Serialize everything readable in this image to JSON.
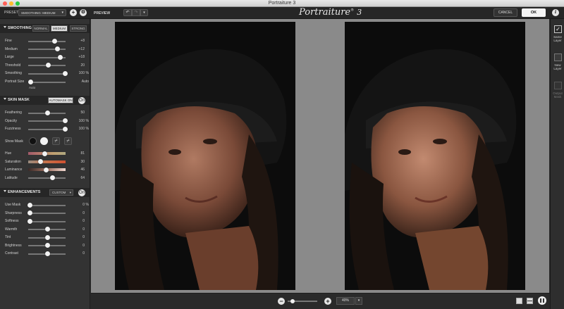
{
  "window": {
    "title": "Portraiture 3"
  },
  "toolbar": {
    "preset_label": "PRESET",
    "preset_value": "SMOOTHING: MEDIUM",
    "preview_label": "PREVIEW",
    "app_logo": "Portraiture",
    "app_logo_sup": "®",
    "app_logo_ver": "3",
    "cancel_label": "CANCEL",
    "ok_label": "OK"
  },
  "smoothing": {
    "header": "SMOOTHING",
    "modes": [
      "NORMAL",
      "MEDIUM",
      "STRONG"
    ],
    "active_mode": "MEDIUM",
    "sliders": [
      {
        "name": "Fine",
        "value": "+8",
        "fraction": 0.7
      },
      {
        "name": "Medium",
        "value": "+12",
        "fraction": 0.78
      },
      {
        "name": "Large",
        "value": "+18",
        "fraction": 0.85
      },
      {
        "name": "Threshold",
        "value": "20",
        "fraction": 0.52
      },
      {
        "name": "Smoothing",
        "value": "100",
        "unit": "%",
        "fraction": 1.0
      }
    ],
    "portrait_size": {
      "name": "Portrait Size",
      "value": "Auto",
      "sub": "Auto",
      "fraction": 0.0
    }
  },
  "skin_mask": {
    "header": "SKIN MASK",
    "automask_label": "AUTOMASK ON",
    "toggle_label": "On",
    "sliders": [
      {
        "name": "Feathering",
        "value": "50",
        "fraction": 0.5
      },
      {
        "name": "Opacity",
        "value": "100",
        "unit": "%",
        "fraction": 1.0
      },
      {
        "name": "Fuzziness",
        "value": "100",
        "unit": "%",
        "fraction": 1.0
      }
    ],
    "show_mask_label": "Show Mask",
    "color_sliders": [
      {
        "name": "Hue",
        "value": "81",
        "fraction": 0.41
      },
      {
        "name": "Saturation",
        "value": "30",
        "fraction": 0.3
      },
      {
        "name": "Luminance",
        "value": "46",
        "fraction": 0.46
      },
      {
        "name": "Latitude",
        "value": "64",
        "fraction": 0.64
      }
    ]
  },
  "enhancements": {
    "header": "ENHANCEMENTS",
    "mode_label": "CUSTOM",
    "toggle_label": "On",
    "sliders": [
      {
        "name": "Use Mask",
        "value": "0",
        "unit": "%",
        "fraction": 0.0
      },
      {
        "name": "Sharpness",
        "value": "0",
        "fraction": 0.0
      },
      {
        "name": "Softness",
        "value": "0",
        "fraction": 0.0
      },
      {
        "name": "Warmth",
        "value": "0",
        "fraction": 0.5
      },
      {
        "name": "Tint",
        "value": "0",
        "fraction": 0.5
      },
      {
        "name": "Brightness",
        "value": "0",
        "fraction": 0.5
      },
      {
        "name": "Contrast",
        "value": "0",
        "fraction": 0.5
      }
    ]
  },
  "output": {
    "same_layer": "Same Layer",
    "new_layer": "New Layer",
    "output_mask": "Output Mask"
  },
  "zoom": {
    "value": "40%",
    "slider_fraction": 0.1
  },
  "colors": {
    "hue_gradient": [
      "#a15a6a",
      "#b87a6a",
      "#c0a070",
      "#b0a880"
    ],
    "sat_gradient": [
      "#9a8c80",
      "#c87048",
      "#d05030"
    ],
    "lum_gradient": [
      "#3a2a28",
      "#a07060",
      "#f0d8d0"
    ]
  }
}
